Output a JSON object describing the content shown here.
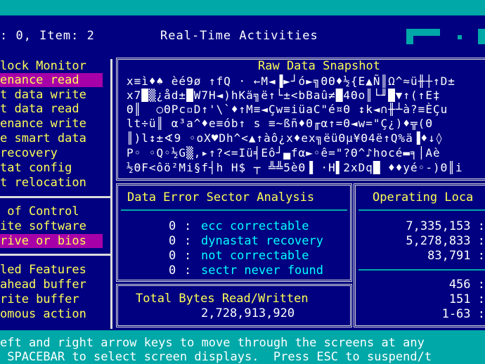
{
  "header": {
    "status": ": 0, Item: 2",
    "title": "Real-Time Activities"
  },
  "left_panel": {
    "block_monitor": {
      "heading": "lock Monitor",
      "items": [
        {
          "label": "enance read",
          "selected": true
        },
        {
          "label": "t data write",
          "selected": false
        },
        {
          "label": "t data read",
          "selected": false
        },
        {
          "label": "enance write",
          "selected": false
        },
        {
          "label": "e smart data",
          "selected": false
        },
        {
          "label": "recovery",
          "selected": false
        },
        {
          "label": "tat config",
          "selected": false
        },
        {
          "label": "t relocation",
          "selected": false
        }
      ]
    },
    "control": {
      "heading": " of Control",
      "items": [
        {
          "label": "ite software",
          "selected": false
        },
        {
          "label": "rive or bios",
          "selected": true
        }
      ]
    },
    "features": {
      "heading": "led Features",
      "items": [
        {
          "label": "ahead buffer"
        },
        {
          "label": "rite buffer"
        },
        {
          "label": "omous action"
        }
      ]
    }
  },
  "raw_snapshot": {
    "title": "Raw Data Snapshot",
    "lines": [
      "x≡ì♦♠ èé9ø ↑fQ · ←M◄▐►┘ó►╗ΘΘ♦½{E▲Ñ║Ω^≈ü╫┼↑D±",
      "x7█▒¿åd±█W7H◄)hKä╗ë↑└±<bBaû≠█4Θo║└╜█▼↑(↑E‡",
      "Θ║  ○ΘPc▫D↑'\\`♦↑M≡◄Çw≡iüaC\"é¤Θ ↕k◄∩╫┴à?≡ÈÇu",
      "lt÷ü║ α³a^♦e≡ób↑ s ≡~ßñ♦Θ╓α↑=Θ◄w=\"Ç¿)♦╦(Θ",
      "║)l↕±∢9 ◦oX♥Dh^<▲↑àô¿x♦ex╗ëüΘμ¥Θ4ë↑Q%ä▐♦↓◊",
      "P◦ ◦Q◦½G▒,▸↑?<=Iü╡Eô┘▄fα►◦ê=\"?Θ^♪hocé▬╕│Aè",
      "½ΘF<ôö²Mi§f┤h H$ ┬ ╩╩5èΘ▐ ·H▌2xDq█ ♦♦yé◦-)Θ║i"
    ]
  },
  "error_analysis": {
    "title": "Data Error Sector Analysis",
    "rows": [
      {
        "count": "0",
        "label": "ecc correctable"
      },
      {
        "count": "0",
        "label": "dynastat recovery"
      },
      {
        "count": "0",
        "label": "not correctable"
      },
      {
        "count": "0",
        "label": "sectr never found"
      }
    ]
  },
  "total_bytes": {
    "title": "Total Bytes Read/Written",
    "value": "2,728,913,920"
  },
  "operating": {
    "title": "Operating Loca",
    "values": [
      "7,335,153 :",
      "5,278,833 :",
      "83,791 :"
    ],
    "lower_values": [
      "456 :",
      "151 :",
      "1-63 :"
    ]
  },
  "footer": {
    "line1": "eft and right arrow keys to move through the screens at any",
    "line2": " SPACEBAR to select screen displays.  Press ESC to suspend/t"
  }
}
